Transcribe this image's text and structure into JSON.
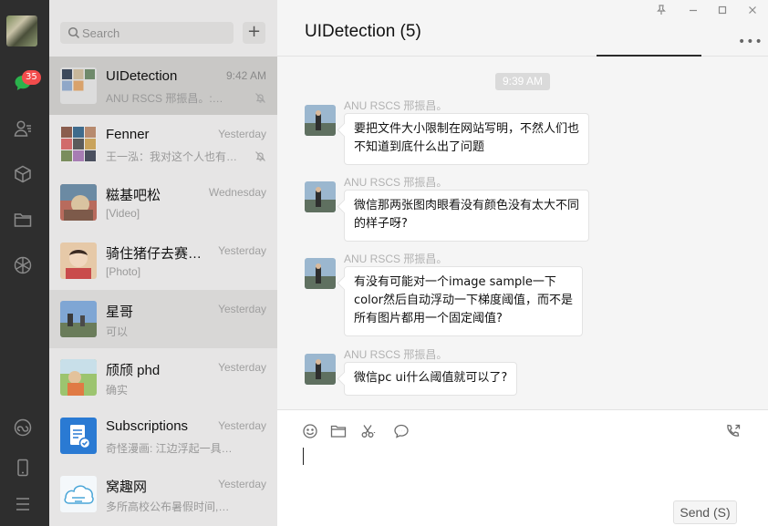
{
  "rail": {
    "badge_count": "35",
    "icons": [
      "chat-icon",
      "contacts-icon",
      "favorites-cube-icon",
      "files-folder-icon",
      "moments-icon",
      "mini-programs-icon",
      "phone-icon",
      "menu-icon"
    ]
  },
  "search": {
    "placeholder": "Search",
    "add_label": "+"
  },
  "conversations": [
    {
      "name": "UIDetection",
      "time": "9:42 AM",
      "preview": "ANU RSCS 邢振昌。:…",
      "muted": true,
      "state": "active"
    },
    {
      "name": "Fenner",
      "time": "Yesterday",
      "preview": "王一泓：我对这个人也有…",
      "muted": true,
      "state": ""
    },
    {
      "name": "糍基吧松",
      "time": "Wednesday",
      "preview": "[Video]",
      "muted": false,
      "state": ""
    },
    {
      "name": "骑住猪仔去赛…",
      "time": "Yesterday",
      "preview": "[Photo]",
      "muted": false,
      "state": ""
    },
    {
      "name": "星哥",
      "time": "Yesterday",
      "preview": "可以",
      "muted": false,
      "state": "hover"
    },
    {
      "name": "颀颀 phd",
      "time": "Yesterday",
      "preview": "确实",
      "muted": false,
      "state": ""
    },
    {
      "name": "Subscriptions",
      "time": "Yesterday",
      "preview": "奇怪漫画: 江边浮起一具…",
      "muted": false,
      "state": ""
    },
    {
      "name": "窝趣网",
      "time": "Yesterday",
      "preview": "多所高校公布暑假时间,…",
      "muted": false,
      "state": ""
    }
  ],
  "chat": {
    "title": "UIDetection (5)",
    "time_chip": "9:39 AM",
    "messages": [
      {
        "sender": "ANU RSCS 邢振昌。",
        "lines": [
          "要把文件大小限制在网站写明，不然人们也",
          "不知道到底什么出了问题"
        ]
      },
      {
        "sender": "ANU RSCS 邢振昌。",
        "lines": [
          "微信那两张图肉眼看没有颜色没有太大不同",
          "的样子呀?"
        ]
      },
      {
        "sender": "ANU RSCS 邢振昌。",
        "lines": [
          "有没有可能对一个image sample一下",
          "color然后自动浮动一下梯度阈值，而不是",
          "所有图片都用一个固定阈值?"
        ]
      },
      {
        "sender": "ANU RSCS 邢振昌。",
        "lines": [
          "微信pc ui什么阈值就可以了?"
        ]
      }
    ],
    "send_label": "Send (S)"
  },
  "colors": {
    "rail_bg": "#2e2e2e",
    "list_bg": "#e6e5e5",
    "badge": "#f24c4c",
    "subscriptions_blue": "#2a7ad3"
  }
}
